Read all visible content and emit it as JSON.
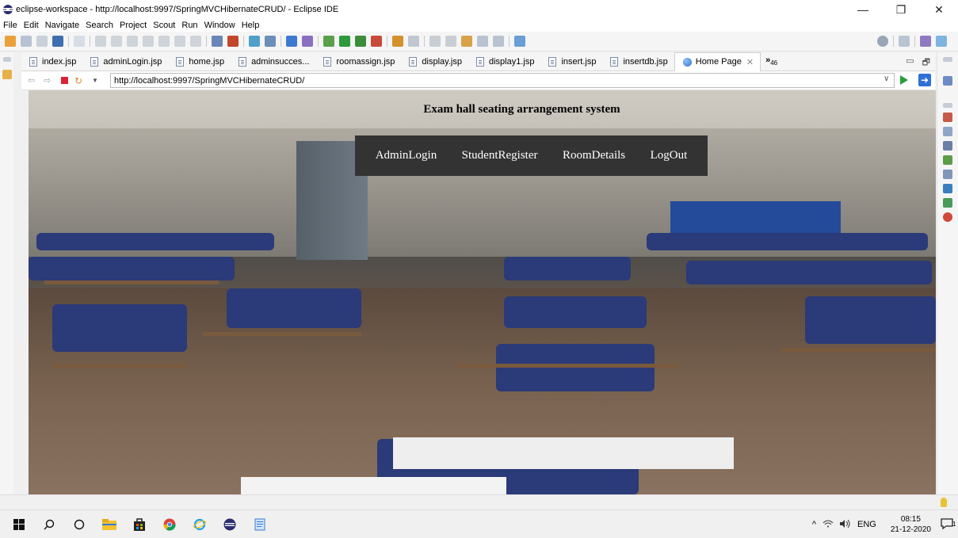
{
  "window": {
    "title": "eclipse-workspace - http://localhost:9997/SpringMVCHibernateCRUD/ - Eclipse IDE",
    "minimize": "—",
    "maximize": "❐",
    "close": "✕"
  },
  "menu": [
    "File",
    "Edit",
    "Navigate",
    "Search",
    "Project",
    "Scout",
    "Run",
    "Window",
    "Help"
  ],
  "tabs": [
    {
      "label": "index.jsp"
    },
    {
      "label": "adminLogin.jsp"
    },
    {
      "label": "home.jsp"
    },
    {
      "label": "adminsucces..."
    },
    {
      "label": "roomassign.jsp"
    },
    {
      "label": "display.jsp"
    },
    {
      "label": "display1.jsp"
    },
    {
      "label": "insert.jsp"
    },
    {
      "label": "insertdb.jsp"
    },
    {
      "label": "Home Page",
      "close": "✕"
    }
  ],
  "tab_overflow": {
    "chevron": "»",
    "count": "46"
  },
  "browser": {
    "url": "http://localhost:9997/SpringMVCHibernateCRUD/"
  },
  "page": {
    "heading": "Exam hall seating arrangement system",
    "nav": [
      "AdminLogin",
      "StudentRegister",
      "RoomDetails",
      "LogOut"
    ]
  },
  "taskbar": {
    "tray_lang": "ENG",
    "time": "08:15",
    "date": "21-12-2020",
    "notifications": "1"
  },
  "colors": {
    "nav_bg": "#333333",
    "nav_text": "#ffffff",
    "stop": "#dd2233",
    "go": "#2a9d3b"
  }
}
